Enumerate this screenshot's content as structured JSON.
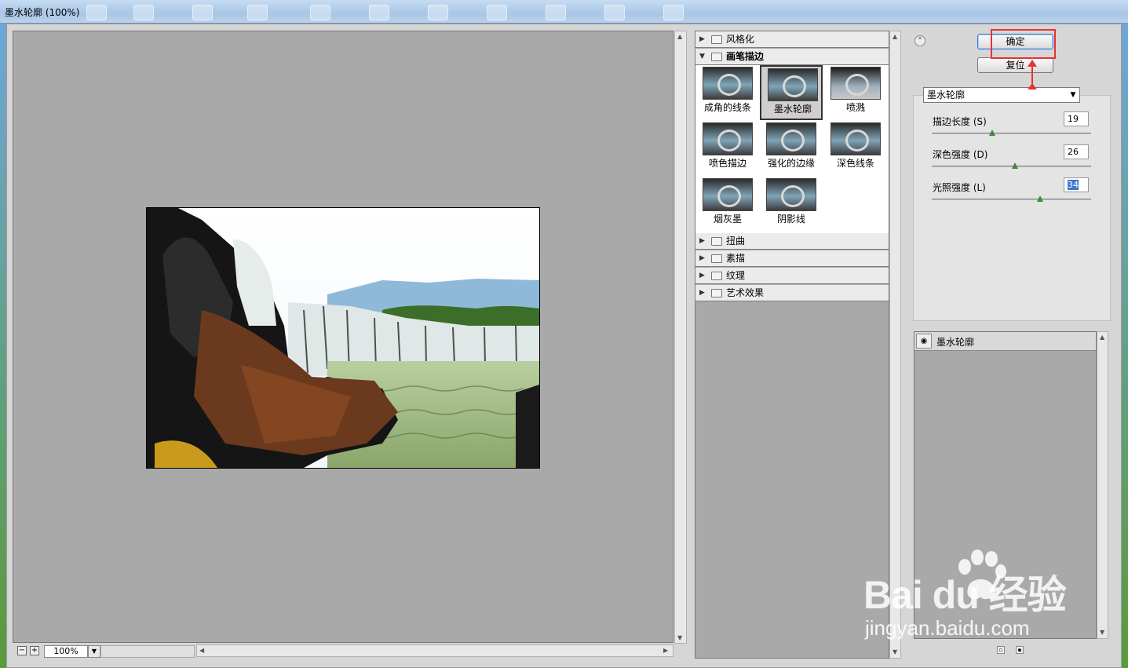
{
  "window": {
    "title": "墨水轮廓 (100%)"
  },
  "preview": {
    "zoom_value": "100%",
    "zoom_out_label": "−",
    "zoom_in_label": "+"
  },
  "gallery": {
    "categories_top": [
      {
        "label": "风格化",
        "expanded": false
      }
    ],
    "open_category": {
      "label": "画笔描边",
      "expanded": true
    },
    "thumbnails": [
      {
        "label": "成角的线条",
        "selected": false
      },
      {
        "label": "墨水轮廓",
        "selected": true
      },
      {
        "label": "喷溅",
        "selected": false
      },
      {
        "label": "喷色描边",
        "selected": false
      },
      {
        "label": "强化的边缘",
        "selected": false
      },
      {
        "label": "深色线条",
        "selected": false
      },
      {
        "label": "烟灰墨",
        "selected": false
      },
      {
        "label": "阴影线",
        "selected": false
      }
    ],
    "categories_bottom": [
      {
        "label": "扭曲",
        "expanded": false
      },
      {
        "label": "素描",
        "expanded": false
      },
      {
        "label": "纹理",
        "expanded": false
      },
      {
        "label": "艺术效果",
        "expanded": false
      }
    ]
  },
  "panel": {
    "ok_label": "确定",
    "reset_label": "复位",
    "filter_select_value": "墨水轮廓",
    "params": [
      {
        "label": "描边长度 (S)",
        "value": "19",
        "level": 0.38,
        "selected": false
      },
      {
        "label": "深色强度 (D)",
        "value": "26",
        "level": 0.52,
        "selected": false
      },
      {
        "label": "光照强度 (L)",
        "value": "34",
        "level": 0.68,
        "selected": true
      }
    ],
    "layer": {
      "name": "墨水轮廓",
      "eye_icon": "eye-icon"
    }
  },
  "watermark": {
    "brand": "Bai du 经验",
    "url": "jingyan.baidu.com"
  },
  "colors": {
    "highlight": "#e53333",
    "accent": "#3a77d0",
    "slider_knob": "#3a8a3a"
  }
}
